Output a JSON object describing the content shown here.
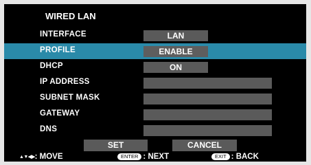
{
  "title": "WIRED LAN",
  "rows": [
    {
      "label": "INTERFACE",
      "value": "LAN"
    },
    {
      "label": "PROFILE",
      "value": "ENABLE"
    },
    {
      "label": "DHCP",
      "value": "ON"
    },
    {
      "label": "IP ADDRESS",
      "value": ""
    },
    {
      "label": "SUBNET MASK",
      "value": ""
    },
    {
      "label": "GATEWAY",
      "value": ""
    },
    {
      "label": "DNS",
      "value": ""
    }
  ],
  "buttons": {
    "set": "SET",
    "cancel": "CANCEL"
  },
  "footer": {
    "move_arrows": "▲▼◀▶",
    "move_label": ": MOVE",
    "enter_key": "ENTER",
    "enter_label": ": NEXT",
    "exit_key": "EXIT",
    "exit_label": ": BACK"
  },
  "colors": {
    "selected_row": "#2a8aa9",
    "field": "#5a5a5a",
    "background": "#000000"
  }
}
